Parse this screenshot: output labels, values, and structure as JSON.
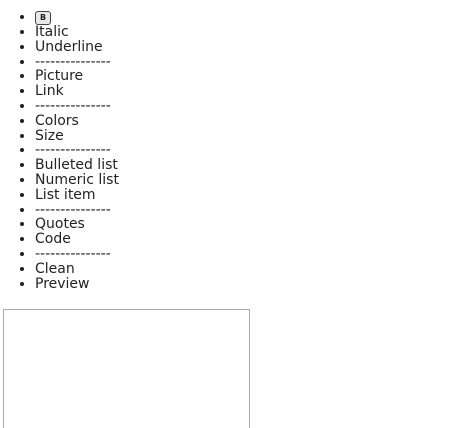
{
  "toolbar": {
    "bold_label": "B",
    "items": [
      {
        "label": "Italic"
      },
      {
        "label": "Underline"
      },
      {
        "label": "---------------"
      },
      {
        "label": "Picture"
      },
      {
        "label": "Link"
      },
      {
        "label": "---------------"
      },
      {
        "label": "Colors"
      },
      {
        "label": "Size"
      },
      {
        "label": "---------------"
      },
      {
        "label": "Bulleted list"
      },
      {
        "label": "Numeric list"
      },
      {
        "label": "List item"
      },
      {
        "label": "---------------"
      },
      {
        "label": "Quotes"
      },
      {
        "label": "Code"
      },
      {
        "label": "---------------"
      },
      {
        "label": "Clean"
      },
      {
        "label": "Preview"
      }
    ]
  },
  "editor": {
    "value": ""
  }
}
